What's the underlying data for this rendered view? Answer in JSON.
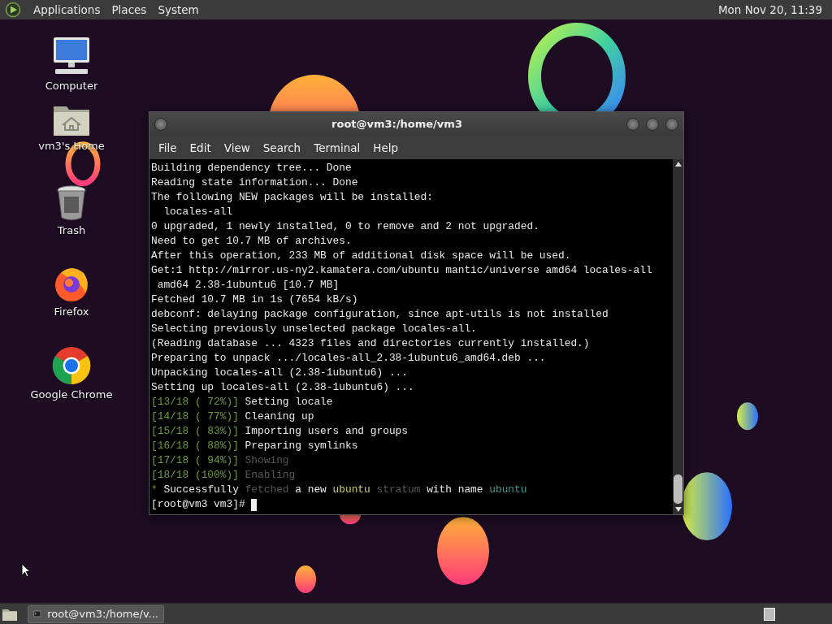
{
  "top_panel": {
    "menus": [
      "Applications",
      "Places",
      "System"
    ],
    "clock": "Mon Nov 20, 11:39"
  },
  "desktop_icons": [
    {
      "label": "Computer",
      "kind": "computer"
    },
    {
      "label": "vm3's Home",
      "kind": "home"
    },
    {
      "label": "Trash",
      "kind": "trash"
    },
    {
      "label": "Firefox",
      "kind": "firefox"
    },
    {
      "label": "Google Chrome",
      "kind": "chrome"
    }
  ],
  "terminal": {
    "title": "root@vm3:/home/vm3",
    "menu": [
      "File",
      "Edit",
      "View",
      "Search",
      "Terminal",
      "Help"
    ],
    "lines": [
      [
        {
          "kind": "plain",
          "text": "Building dependency tree... Done"
        }
      ],
      [
        {
          "kind": "plain",
          "text": "Reading state information... Done"
        }
      ],
      [
        {
          "kind": "plain",
          "text": "The following NEW packages will be installed:"
        }
      ],
      [
        {
          "kind": "plain",
          "text": "  locales-all"
        }
      ],
      [
        {
          "kind": "plain",
          "text": "0 upgraded, 1 newly installed, 0 to remove and 2 not upgraded."
        }
      ],
      [
        {
          "kind": "plain",
          "text": "Need to get 10.7 MB of archives."
        }
      ],
      [
        {
          "kind": "plain",
          "text": "After this operation, 233 MB of additional disk space will be used."
        }
      ],
      [
        {
          "kind": "plain",
          "text": "Get:1 http://mirror.us-ny2.kamatera.com/ubuntu mantic/universe amd64 locales-all"
        }
      ],
      [
        {
          "kind": "plain",
          "text": " amd64 2.38-1ubuntu6 [10.7 MB]"
        }
      ],
      [
        {
          "kind": "plain",
          "text": "Fetched 10.7 MB in 1s (7654 kB/s)"
        }
      ],
      [
        {
          "kind": "plain",
          "text": "debconf: delaying package configuration, since apt-utils is not installed"
        }
      ],
      [
        {
          "kind": "plain",
          "text": "Selecting previously unselected package locales-all."
        }
      ],
      [
        {
          "kind": "plain",
          "text": "(Reading database ... 4323 files and directories currently installed.)"
        }
      ],
      [
        {
          "kind": "plain",
          "text": "Preparing to unpack .../locales-all_2.38-1ubuntu6_amd64.deb ..."
        }
      ],
      [
        {
          "kind": "plain",
          "text": "Unpacking locales-all (2.38-1ubuntu6) ..."
        }
      ],
      [
        {
          "kind": "plain",
          "text": "Setting up locales-all (2.38-1ubuntu6) ..."
        }
      ],
      [
        {
          "kind": "progress",
          "text": "[13/18 ( 72%)]"
        },
        {
          "kind": "plain",
          "text": " Setting locale"
        }
      ],
      [
        {
          "kind": "progress",
          "text": "[14/18 ( 77%)]"
        },
        {
          "kind": "plain",
          "text": " Cleaning up"
        }
      ],
      [
        {
          "kind": "progress",
          "text": "[15/18 ( 83%)]"
        },
        {
          "kind": "plain",
          "text": " Importing users and groups"
        }
      ],
      [
        {
          "kind": "progress",
          "text": "[16/18 ( 88%)]"
        },
        {
          "kind": "plain",
          "text": " Preparing symlinks"
        }
      ],
      [
        {
          "kind": "progress",
          "text": "[17/18 ( 94%)]"
        },
        {
          "kind": "dim",
          "text": " Showing"
        }
      ],
      [
        {
          "kind": "progress",
          "text": "[18/18 (100%)]"
        },
        {
          "kind": "dim",
          "text": " Enabling"
        }
      ],
      [
        {
          "kind": "progress",
          "text": "*"
        },
        {
          "kind": "plain",
          "text": " Successfully "
        },
        {
          "kind": "dim",
          "text": "fetched"
        },
        {
          "kind": "plain",
          "text": " a new "
        },
        {
          "kind": "yellow",
          "text": "ubuntu"
        },
        {
          "kind": "dim",
          "text": " stratum"
        },
        {
          "kind": "plain",
          "text": " with name "
        },
        {
          "kind": "teal",
          "text": "ubuntu"
        }
      ],
      [
        {
          "kind": "plain",
          "text": "[root@vm3 vm3]# "
        }
      ]
    ],
    "cursor_visible": true
  },
  "taskbar": {
    "tasks": [
      {
        "label": "root@vm3:/home/v..."
      }
    ]
  }
}
